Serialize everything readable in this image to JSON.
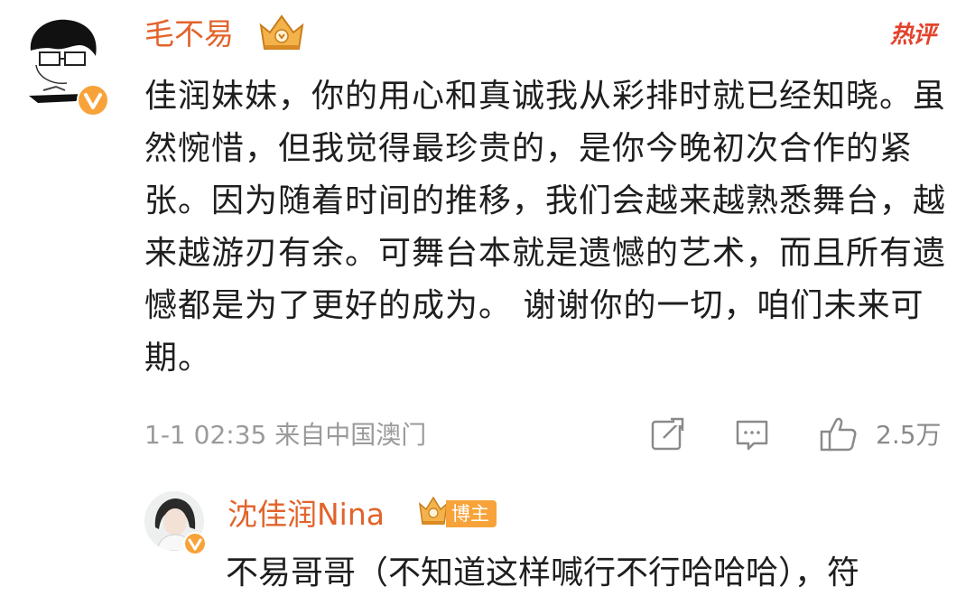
{
  "comment": {
    "username": "毛不易",
    "hot_tag": "热评",
    "text": "佳润妹妹，你的用心和真诚我从彩排时就已经知晓。虽然惋惜，但我觉得最珍贵的，是你今晚初次合作的紧张。因为随着时间的推移，我们会越来越熟悉舞台，越来越游刃有余。可舞台本就是遗憾的艺术，而且所有遗憾都是为了更好的成为。 谢谢你的一切，咱们未来可期。",
    "meta": "1-1 02:35 来自中国澳门",
    "like_count": "2.5万",
    "icons": {
      "share": "share-icon",
      "comment": "comment-icon",
      "like": "thumbs-up-icon",
      "verified": "verified-v-icon",
      "crown": "crown-badge-icon"
    }
  },
  "reply": {
    "username": "沈佳润Nina",
    "badge_label": "博主",
    "text": "不易哥哥（不知道这样喊行不行哈哈哈），符"
  },
  "colors": {
    "username": "#e2632b",
    "hot_tag": "#e2432b",
    "meta": "#9a9a9a",
    "verified": "#f7a33a",
    "badge": "#f7a33a"
  }
}
